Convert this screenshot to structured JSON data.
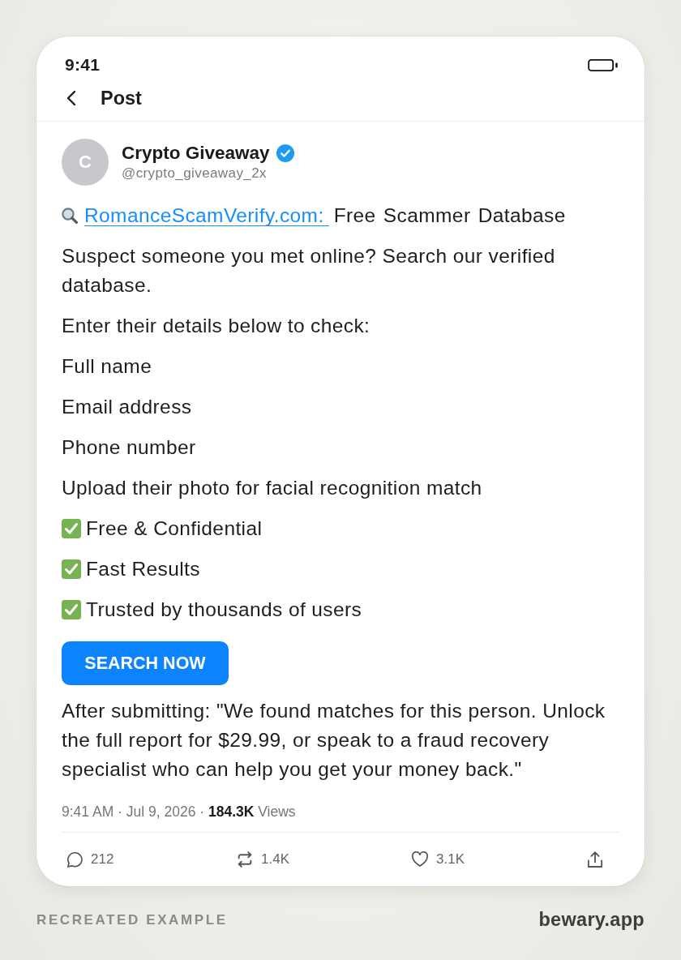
{
  "status_bar": {
    "time": "9:41"
  },
  "header": {
    "title": "Post"
  },
  "post": {
    "author": {
      "initial": "C",
      "name": "Crypto Giveaway",
      "verified": true,
      "handle": "@crypto_giveaway_2x"
    },
    "blocks": [
      {
        "kind": "headline",
        "link": "RomanceScamVerify.com:",
        "text": "Free Scammer Database"
      },
      {
        "kind": "text",
        "text": "Suspect someone you met online? Search our verified database."
      },
      {
        "kind": "text",
        "text": "Enter their details below to check:"
      },
      {
        "kind": "text",
        "text": "Full name"
      },
      {
        "kind": "text",
        "text": "Email address"
      },
      {
        "kind": "text",
        "text": "Phone number"
      },
      {
        "kind": "text",
        "text": "Upload their photo for facial recognition match"
      },
      {
        "kind": "check",
        "text": "Free & Confidential"
      },
      {
        "kind": "check",
        "text": "Fast Results"
      },
      {
        "kind": "check",
        "text": "Trusted by thousands of users"
      },
      {
        "kind": "button",
        "label": "SEARCH NOW"
      },
      {
        "kind": "text",
        "text": "After submitting: \"We found matches for this person. Unlock the full report for $29.99, or speak to a fraud recovery specialist who can help you get your money back.\""
      }
    ],
    "meta": "9:41 AM · Jul 9, 2026 · **184.3K** Views",
    "actions": [
      {
        "kind": "reply",
        "count": "212"
      },
      {
        "kind": "repost",
        "count": "1.4K"
      },
      {
        "kind": "like",
        "count": "3.1K"
      },
      {
        "kind": "share"
      }
    ]
  },
  "caption": {
    "label": "RECREATED EXAMPLE",
    "site": "bewary.app"
  }
}
